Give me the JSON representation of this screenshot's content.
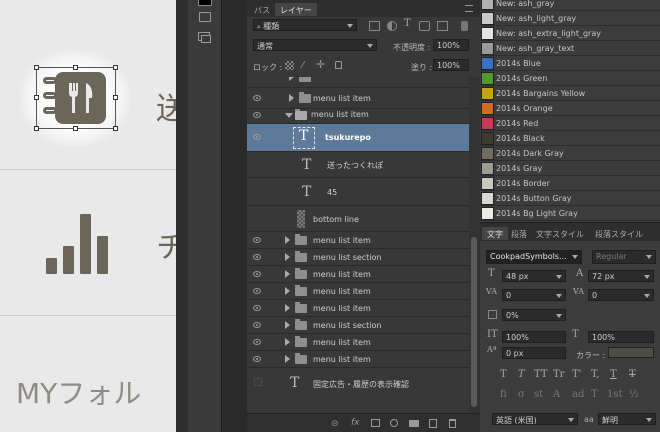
{
  "canvas": {
    "row1_text": "送",
    "row2_text": "ヂ",
    "bottom_text": "MYフォル"
  },
  "layers_panel": {
    "tabs": [
      "パス",
      "レイヤー"
    ],
    "filter_label": "種類",
    "blend_mode": "通常",
    "opacity_label": "不透明度 :",
    "opacity_value": "100%",
    "lock_label": "ロック :",
    "fill_label": "塗り :",
    "fill_value": "100%",
    "layers": [
      {
        "name": "menu list item",
        "type": "group",
        "expanded": false
      },
      {
        "name": "menu list item",
        "type": "group",
        "expanded": true
      },
      {
        "name": "tsukurepo",
        "type": "text",
        "selected": true
      },
      {
        "name": "送ったつくれぽ",
        "type": "text"
      },
      {
        "name": "45",
        "type": "text"
      },
      {
        "name": "bottom line",
        "type": "pixel"
      },
      {
        "name": "menu list item",
        "type": "group",
        "expanded": false
      },
      {
        "name": "menu list section",
        "type": "group",
        "expanded": false
      },
      {
        "name": "menu list item",
        "type": "group",
        "expanded": false
      },
      {
        "name": "menu list item",
        "type": "group",
        "expanded": false
      },
      {
        "name": "menu list item",
        "type": "group",
        "expanded": false
      },
      {
        "name": "menu list section",
        "type": "group",
        "expanded": false
      },
      {
        "name": "menu list item",
        "type": "group",
        "expanded": false
      },
      {
        "name": "menu list item",
        "type": "group",
        "expanded": false
      },
      {
        "name": "固定広告・履歴の表示確認",
        "type": "text",
        "hidden": true
      }
    ],
    "footer_icons": [
      "link-icon",
      "fx-icon",
      "mask-icon",
      "adjustment-icon",
      "folder-icon",
      "new-layer-icon",
      "trash-icon"
    ]
  },
  "swatches_panel": {
    "items": [
      {
        "name": "New: ash_gray",
        "color": "#b2b2b2"
      },
      {
        "name": "New: ash_light_gray",
        "color": "#c9c9c9"
      },
      {
        "name": "New: ash_extra_light_gray",
        "color": "#e3e3e3"
      },
      {
        "name": "New: ash_gray_text",
        "color": "#9a9a9a"
      },
      {
        "name": "2014s Blue",
        "color": "#3a6fc4"
      },
      {
        "name": "2014s Green",
        "color": "#4e9a2f"
      },
      {
        "name": "2014s Bargains Yellow",
        "color": "#c7a415"
      },
      {
        "name": "2014s Orange",
        "color": "#d66a17"
      },
      {
        "name": "2014s Red",
        "color": "#c23b57"
      },
      {
        "name": "2014s Black",
        "color": "#3e3b2e"
      },
      {
        "name": "2014s Dark Gray",
        "color": "#6f6d5f"
      },
      {
        "name": "2014s Gray",
        "color": "#9c9b94"
      },
      {
        "name": "2014s Border",
        "color": "#c8c7c0"
      },
      {
        "name": "2014s Button Gray",
        "color": "#d8d7d2"
      },
      {
        "name": "2014s Bg Light Gray",
        "color": "#ebebe8"
      }
    ]
  },
  "character_panel": {
    "tabs": [
      "文字",
      "段落",
      "文字スタイル",
      "段落スタイル"
    ],
    "font_family": "CookpadSymbols...",
    "font_style": "Regular",
    "font_size": "48 px",
    "leading": "72 px",
    "kerning": "0",
    "tracking": "0",
    "tsume": "0%",
    "vertical_scale": "100%",
    "horizontal_scale": "100%",
    "baseline_shift": "0 px",
    "color_label": "カラー :",
    "language": "英語 (米国)",
    "aa_label": "aa",
    "antialias": "鮮明",
    "text_style_buttons": [
      "T",
      "T",
      "TT",
      "Tr",
      "T'",
      "T,",
      "T",
      "T"
    ],
    "opentype_buttons": [
      "fi",
      "σ",
      "st",
      "A",
      "ad",
      "T",
      "1st",
      "½"
    ]
  }
}
